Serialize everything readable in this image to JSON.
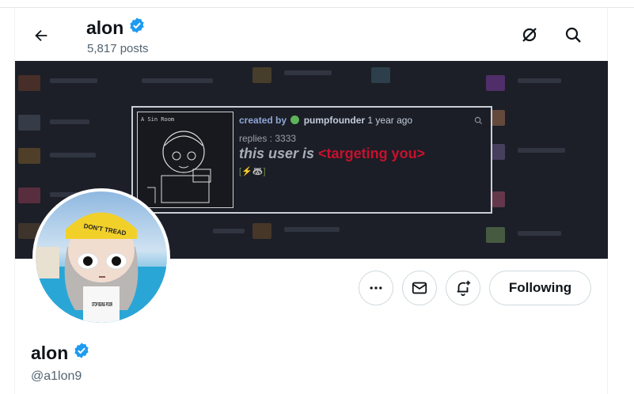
{
  "header": {
    "name": "alon",
    "posts": "5,817 posts"
  },
  "icons": {
    "back": "back-arrow-icon",
    "grok": "grok-icon",
    "search": "search-icon",
    "verified": "verified-badge-icon"
  },
  "banner": {
    "card": {
      "created_by": "created by",
      "author": "pumpfounder",
      "time": "1 year ago",
      "replies": "replies : 3333",
      "headline_prefix": "this user is ",
      "headline_highlight": "<targeting you>",
      "emoji_line": "[⚡🦝]",
      "thumb_title": "A Sin Room"
    }
  },
  "avatar": {
    "hat_text": "DON'T TREAD",
    "shirt_text": "STOP BEING POOR"
  },
  "actions": {
    "more": "more-icon",
    "message": "mail-icon",
    "notify": "bell-plus-icon",
    "follow_label": "Following"
  },
  "profile": {
    "name": "alon",
    "handle": "@a1lon9"
  },
  "colors": {
    "verified": "#1d9bf0",
    "muted": "#536471",
    "highlight_red": "#c8102e"
  }
}
